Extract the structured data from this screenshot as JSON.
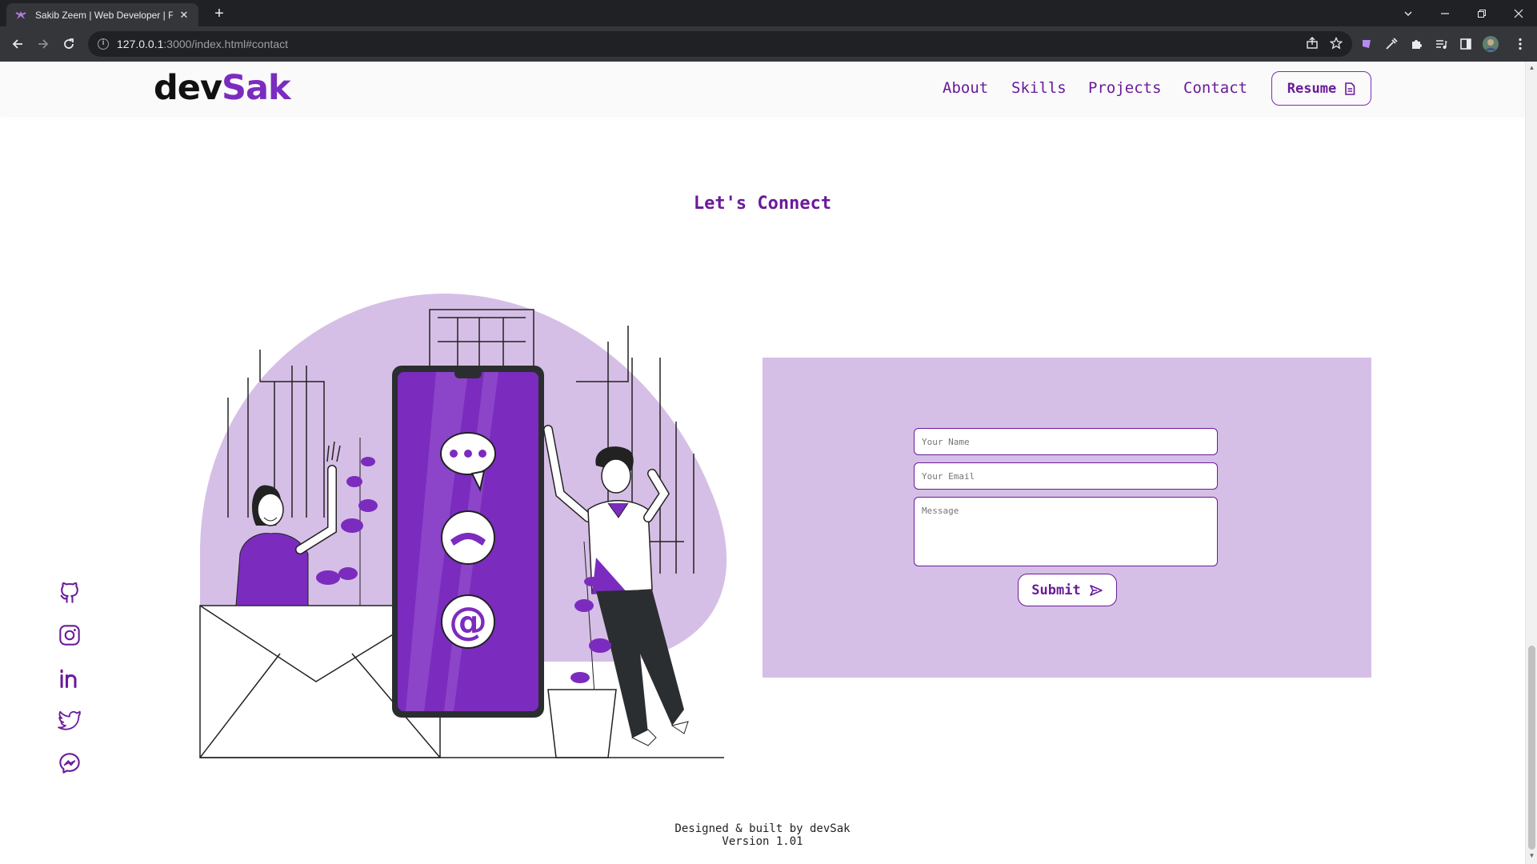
{
  "browser": {
    "tab_title": "Sakib Zeem | Web Developer | F",
    "url_host": "127.0.0.1",
    "url_path": ":3000/index.html#contact"
  },
  "site": {
    "logo_part1": "dev",
    "logo_part2": "Sak",
    "nav": [
      "About",
      "Skills",
      "Projects",
      "Contact"
    ],
    "resume_label": "Resume",
    "section_title": "Let's Connect",
    "form": {
      "name_placeholder": "Your Name",
      "email_placeholder": "Your Email",
      "message_placeholder": "Message",
      "submit_label": "Submit"
    },
    "socials": [
      "github-icon",
      "instagram-icon",
      "linkedin-icon",
      "twitter-icon",
      "messenger-icon"
    ],
    "footer_line1": "Designed & built by devSak",
    "footer_line2": "Version 1.01",
    "accent_color": "#7b2cbf",
    "card_color": "#d6bfe6"
  }
}
